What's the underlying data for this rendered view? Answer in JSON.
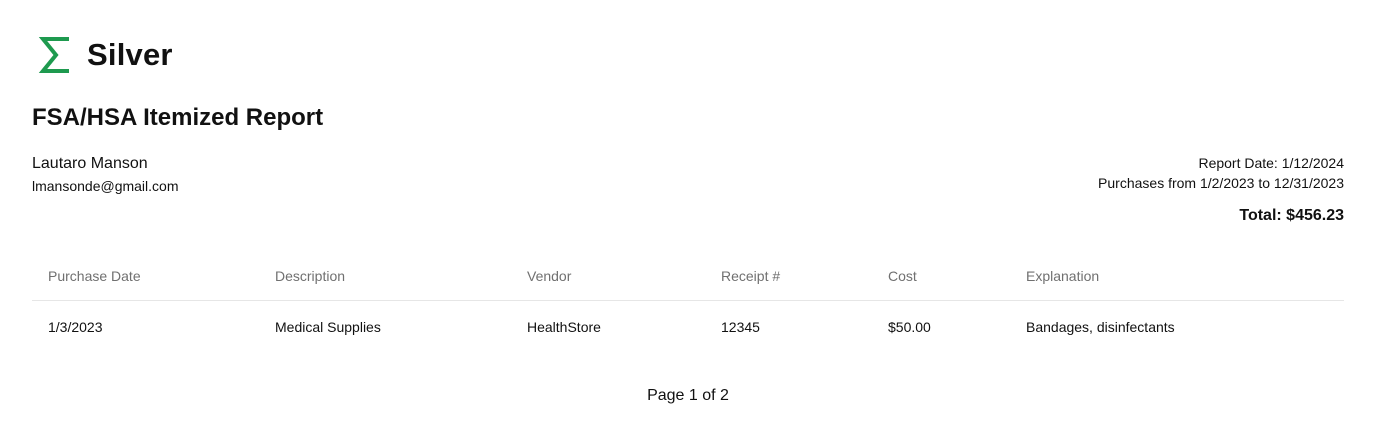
{
  "brand": {
    "name": "Silver",
    "icon": "sigma-icon",
    "color": "#1e9a4f"
  },
  "report": {
    "title": "FSA/HSA Itemized Report",
    "user_name": "Lautaro Manson",
    "user_email": "lmansonde@gmail.com",
    "report_date": "Report Date: 1/12/2024",
    "purchase_range": "Purchases from 1/2/2023 to 12/31/2023",
    "total": "Total: $456.23"
  },
  "table": {
    "columns": [
      "Purchase Date",
      "Description",
      "Vendor",
      "Receipt #",
      "Cost",
      "Explanation"
    ],
    "rows": [
      [
        "1/3/2023",
        "Medical Supplies",
        "HealthStore",
        "12345",
        "$50.00",
        "Bandages, disinfectants"
      ]
    ]
  },
  "pagination": {
    "label": "Page 1 of 2"
  }
}
